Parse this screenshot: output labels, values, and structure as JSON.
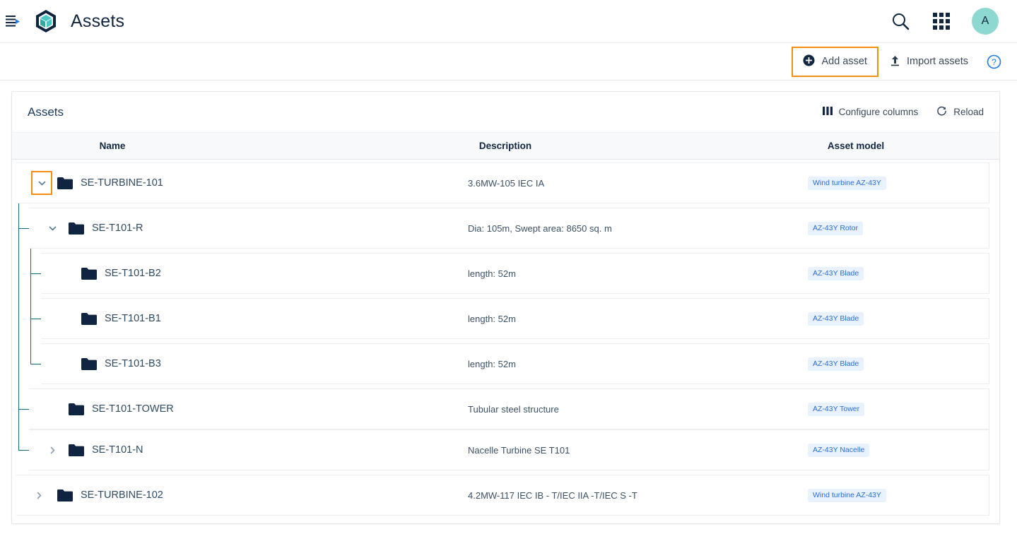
{
  "appbar": {
    "menu_icon": "menu-expand-icon",
    "logo_icon": "cube-hexagon-logo",
    "title": "Assets",
    "search_icon": "search-icon",
    "apps_icon": "apps-grid-icon",
    "avatar_initial": "A"
  },
  "toolbar": {
    "add_asset_label": "Add asset",
    "add_asset_icon": "plus-circle-icon",
    "import_assets_label": "Import assets",
    "import_assets_icon": "upload-icon",
    "help_icon": "help-circle-icon"
  },
  "card": {
    "title": "Assets",
    "configure_columns_label": "Configure columns",
    "configure_columns_icon": "columns-icon",
    "reload_label": "Reload",
    "reload_icon": "refresh-icon"
  },
  "table": {
    "columns": [
      "Name",
      "Description",
      "Asset model"
    ],
    "rows": [
      {
        "name": "SE-TURBINE-101",
        "description": "3.6MW-105 IEC IA",
        "asset_model": "Wind turbine AZ-43Y",
        "level": 0,
        "expanded": true,
        "has_children": true,
        "highlighted": true
      },
      {
        "name": "SE-T101-R",
        "description": "Dia: 105m, Swept area: 8650 sq. m",
        "asset_model": "AZ-43Y Rotor",
        "level": 1,
        "expanded": true,
        "has_children": true,
        "highlighted": false
      },
      {
        "name": "SE-T101-B2",
        "description": "length: 52m",
        "asset_model": "AZ-43Y Blade",
        "level": 2,
        "expanded": false,
        "has_children": false,
        "highlighted": false
      },
      {
        "name": "SE-T101-B1",
        "description": "length: 52m",
        "asset_model": "AZ-43Y Blade",
        "level": 2,
        "expanded": false,
        "has_children": false,
        "highlighted": false
      },
      {
        "name": "SE-T101-B3",
        "description": "length: 52m",
        "asset_model": "AZ-43Y Blade",
        "level": 2,
        "expanded": false,
        "has_children": false,
        "highlighted": false
      },
      {
        "name": "SE-T101-TOWER",
        "description": "Tubular steel structure",
        "asset_model": "AZ-43Y Tower",
        "level": 1,
        "expanded": false,
        "has_children": false,
        "highlighted": false
      },
      {
        "name": "SE-T101-N",
        "description": "Nacelle Turbine SE T101",
        "asset_model": "AZ-43Y Nacelle",
        "level": 1,
        "expanded": false,
        "has_children": true,
        "highlighted": false
      },
      {
        "name": "SE-TURBINE-102",
        "description": "4.2MW-117 IEC IB - T/IEC IIA -T/IEC S -T",
        "asset_model": "Wind turbine AZ-43Y",
        "level": 0,
        "expanded": false,
        "has_children": true,
        "highlighted": false
      }
    ]
  },
  "colors": {
    "brand_dark": "#12263f",
    "brand_teal": "#3fc2bd",
    "accent_orange": "#f29111",
    "badge_bg": "#e8f1fe",
    "badge_text": "#2b6fd6",
    "tree_line": "#0f6e7b",
    "link_blue": "#1e7ae8"
  }
}
